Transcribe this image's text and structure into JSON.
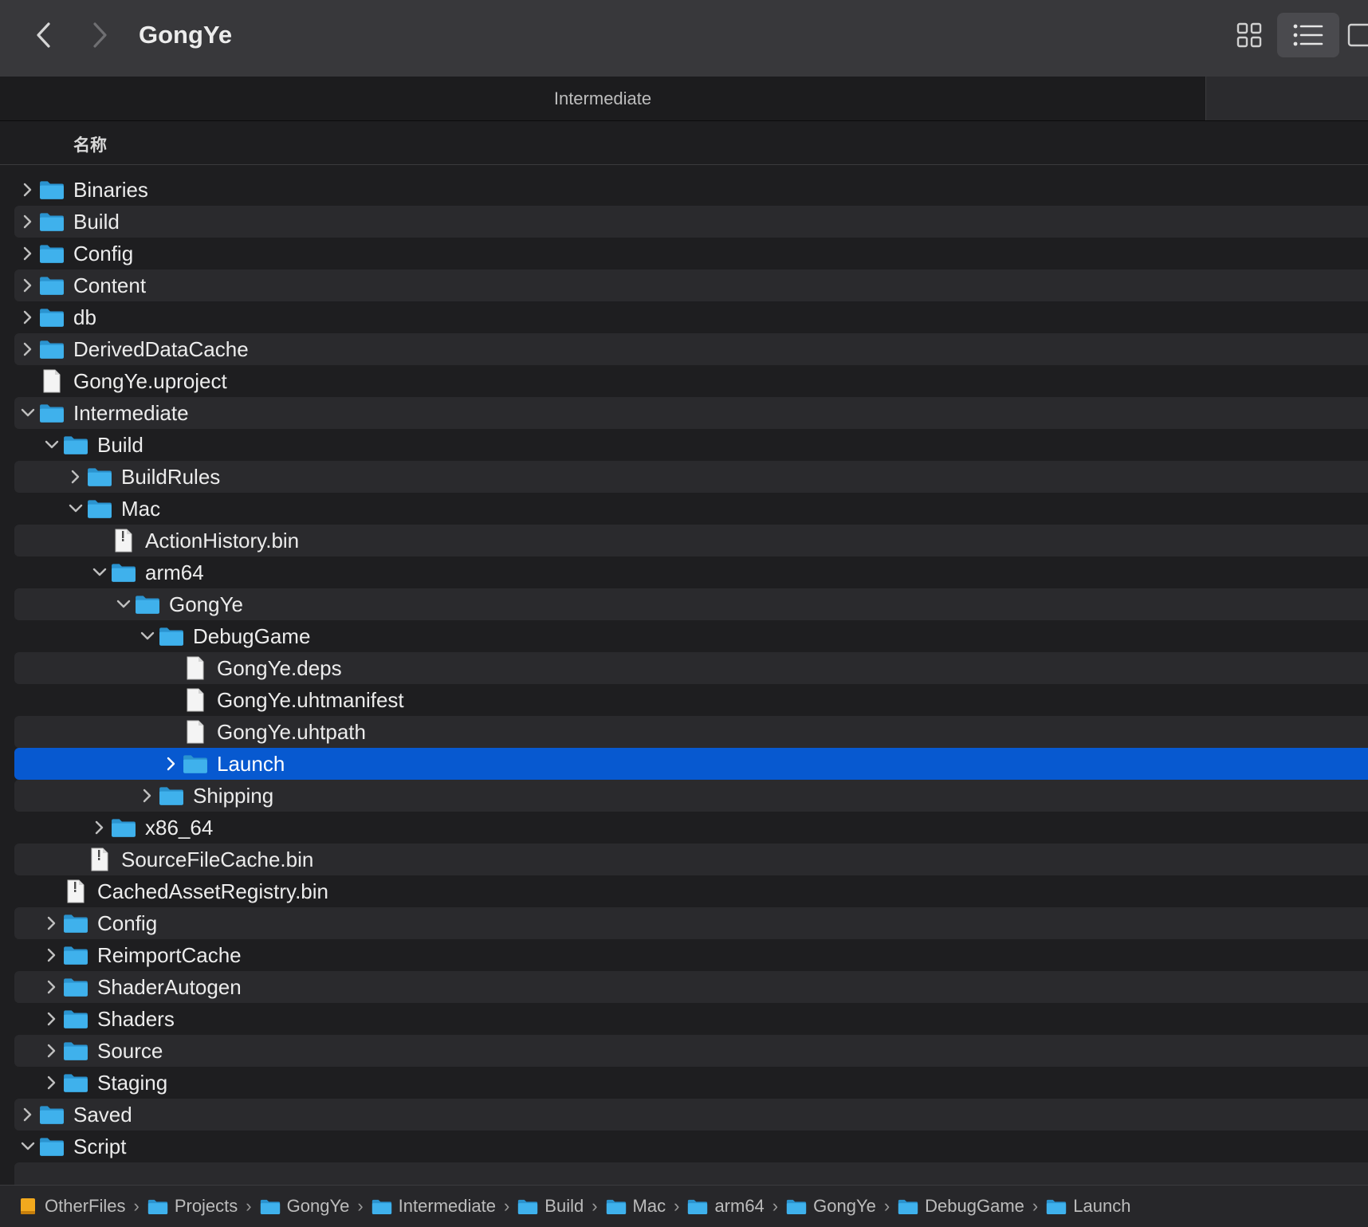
{
  "window": {
    "title": "GongYe"
  },
  "tab": {
    "label": "Intermediate"
  },
  "column_header": {
    "name": "名称"
  },
  "rows": [
    {
      "label": "Binaries",
      "type": "folder",
      "depth": 0,
      "expanded": false
    },
    {
      "label": "Build",
      "type": "folder",
      "depth": 0,
      "expanded": false
    },
    {
      "label": "Config",
      "type": "folder",
      "depth": 0,
      "expanded": false
    },
    {
      "label": "Content",
      "type": "folder",
      "depth": 0,
      "expanded": false
    },
    {
      "label": "db",
      "type": "folder",
      "depth": 0,
      "expanded": false
    },
    {
      "label": "DerivedDataCache",
      "type": "folder",
      "depth": 0,
      "expanded": false
    },
    {
      "label": "GongYe.uproject",
      "type": "file",
      "depth": 0
    },
    {
      "label": "Intermediate",
      "type": "folder",
      "depth": 0,
      "expanded": true
    },
    {
      "label": "Build",
      "type": "folder",
      "depth": 1,
      "expanded": true
    },
    {
      "label": "BuildRules",
      "type": "folder",
      "depth": 2,
      "expanded": false
    },
    {
      "label": "Mac",
      "type": "folder",
      "depth": 2,
      "expanded": true
    },
    {
      "label": "ActionHistory.bin",
      "type": "binfile",
      "depth": 3
    },
    {
      "label": "arm64",
      "type": "folder",
      "depth": 3,
      "expanded": true
    },
    {
      "label": "GongYe",
      "type": "folder",
      "depth": 4,
      "expanded": true
    },
    {
      "label": "DebugGame",
      "type": "folder",
      "depth": 5,
      "expanded": true
    },
    {
      "label": "GongYe.deps",
      "type": "file",
      "depth": 6
    },
    {
      "label": "GongYe.uhtmanifest",
      "type": "file",
      "depth": 6
    },
    {
      "label": "GongYe.uhtpath",
      "type": "file",
      "depth": 6
    },
    {
      "label": "Launch",
      "type": "folder",
      "depth": 6,
      "expanded": false,
      "selected": true
    },
    {
      "label": "Shipping",
      "type": "folder",
      "depth": 5,
      "expanded": false
    },
    {
      "label": "x86_64",
      "type": "folder",
      "depth": 3,
      "expanded": false
    },
    {
      "label": "SourceFileCache.bin",
      "type": "binfile",
      "depth": 2
    },
    {
      "label": "CachedAssetRegistry.bin",
      "type": "binfile",
      "depth": 1
    },
    {
      "label": "Config",
      "type": "folder",
      "depth": 1,
      "expanded": false
    },
    {
      "label": "ReimportCache",
      "type": "folder",
      "depth": 1,
      "expanded": false
    },
    {
      "label": "ShaderAutogen",
      "type": "folder",
      "depth": 1,
      "expanded": false
    },
    {
      "label": "Shaders",
      "type": "folder",
      "depth": 1,
      "expanded": false
    },
    {
      "label": "Source",
      "type": "folder",
      "depth": 1,
      "expanded": false
    },
    {
      "label": "Staging",
      "type": "folder",
      "depth": 1,
      "expanded": false
    },
    {
      "label": "Saved",
      "type": "folder",
      "depth": 0,
      "expanded": false
    },
    {
      "label": "Script",
      "type": "folder",
      "depth": 0,
      "expanded": true
    },
    {
      "label": "",
      "type": "empty",
      "depth": 0
    }
  ],
  "path_bar": [
    {
      "label": "OtherFiles",
      "icon": "drive-icon"
    },
    {
      "label": "Projects",
      "icon": "folder-icon"
    },
    {
      "label": "GongYe",
      "icon": "folder-icon"
    },
    {
      "label": "Intermediate",
      "icon": "folder-icon"
    },
    {
      "label": "Build",
      "icon": "folder-icon"
    },
    {
      "label": "Mac",
      "icon": "folder-icon"
    },
    {
      "label": "arm64",
      "icon": "folder-icon"
    },
    {
      "label": "GongYe",
      "icon": "folder-icon"
    },
    {
      "label": "DebugGame",
      "icon": "folder-icon"
    },
    {
      "label": "Launch",
      "icon": "folder-icon"
    }
  ],
  "colors": {
    "selection": "#0759d0",
    "folder": "#3fb1ec",
    "background": "#1e1e20"
  }
}
